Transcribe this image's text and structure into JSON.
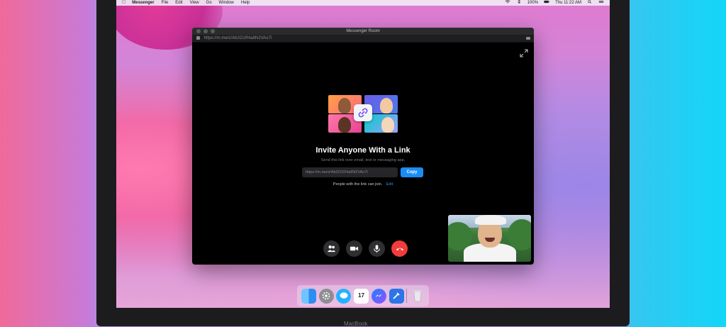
{
  "menubar": {
    "app_name": "Messenger",
    "menus": [
      "File",
      "Edit",
      "View",
      "Go",
      "Window",
      "Help"
    ],
    "battery": "100%",
    "clock": "Thu 11:22 AM"
  },
  "window": {
    "title": "Messenger Room",
    "url": "https://m.me/z/Ab2O1R4a9N2VAo7l"
  },
  "invite": {
    "title": "Invite Anyone With a Link",
    "subtitle": "Send this link over email, text or messaging app.",
    "link_value": "https://m.me/z/Ab2O1R4a9N2VAo7l",
    "copy_label": "Copy",
    "people_text": "People with the link can join.",
    "edit_label": "Edit"
  },
  "dock": {
    "calendar_day": "17"
  },
  "device_label": "MacBook",
  "colors": {
    "accent": "#1a8cf6",
    "end_call": "#f23b3b",
    "window_bg": "#000000"
  }
}
